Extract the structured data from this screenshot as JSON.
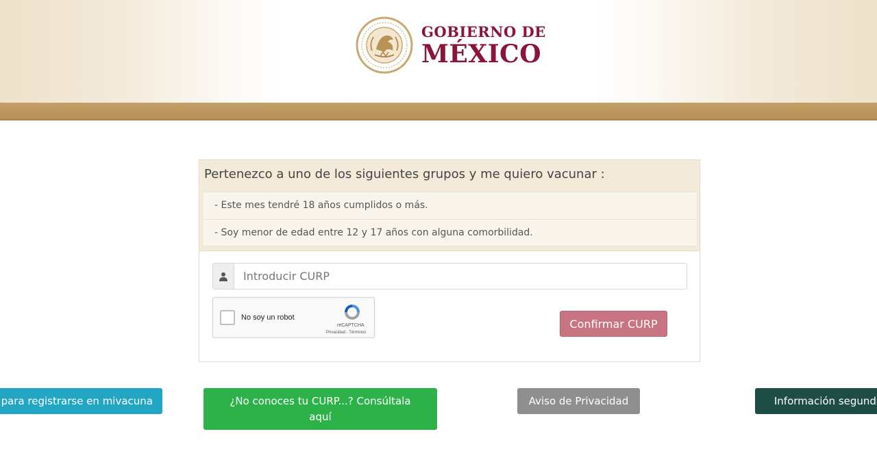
{
  "header": {
    "gov_line1": "GOBIERNO DE",
    "gov_line2": "MÉXICO",
    "seal_icon": "mexico-coat-of-arms-icon"
  },
  "colors": {
    "brand_red": "#8a1538",
    "band_gold": "#b58f56",
    "confirm_button": "#c87482",
    "register_button": "#22a6c4",
    "consulta_button": "#2db24a",
    "aviso_button": "#8f8f8f",
    "info_button": "#1d4d44"
  },
  "panel": {
    "title": "Pertenezco a uno de los siguientes grupos y me quiero vacunar :",
    "items": [
      "- Este mes tendré 18 años cumplidos o más.",
      "- Soy menor de edad entre 12 y 17 años con alguna comorbilidad."
    ]
  },
  "form": {
    "curp_placeholder": "Introducir CURP",
    "curp_value": "",
    "user_icon": "user-icon",
    "captcha": {
      "label": "No soy un robot",
      "brand": "reCAPTCHA",
      "links": "Privacidad - Términos",
      "icon": "recaptcha-icon"
    },
    "confirm_label": "Confirmar CURP"
  },
  "footer_buttons": {
    "register_label": "para registrarse en mivacuna",
    "consulta_label": "¿No conoces tu CURP...? Consúltala aquí",
    "aviso_label": "Aviso de Privacidad",
    "info_label": "Información segunda"
  }
}
